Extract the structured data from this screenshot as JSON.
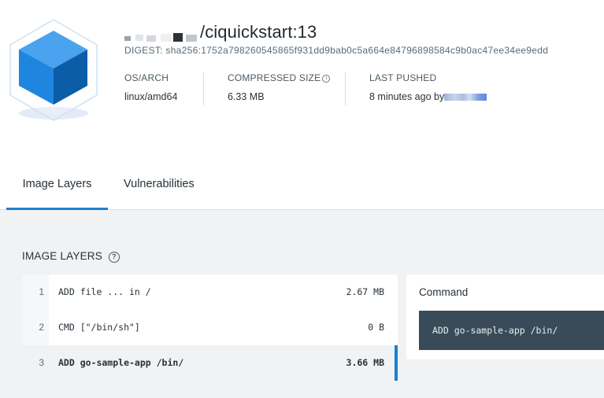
{
  "image": {
    "title_suffix": "/ciquickstart:13",
    "digest": "DIGEST: sha256:1752a798260545865f931dd9bab0c5a664e84796898584c9b0ac47ee34ee9edd"
  },
  "meta": {
    "os_arch_label": "OS/ARCH",
    "os_arch_value": "linux/amd64",
    "compressed_size_label": "COMPRESSED SIZE",
    "compressed_size_value": "6.33 MB",
    "last_pushed_label": "LAST PUSHED",
    "last_pushed_value": "8 minutes ago by"
  },
  "tabs": [
    {
      "label": "Image Layers",
      "active": true
    },
    {
      "label": "Vulnerabilities",
      "active": false
    }
  ],
  "layers_section": {
    "title": "IMAGE LAYERS",
    "rows": [
      {
        "num": "1",
        "command": "ADD file ... in /",
        "size": "2.67 MB"
      },
      {
        "num": "2",
        "command": "CMD [\"/bin/sh\"]",
        "size": "0 B"
      },
      {
        "num": "3",
        "command": "ADD go-sample-app /bin/",
        "size": "3.66 MB"
      }
    ],
    "selected_index": 2
  },
  "command_panel": {
    "label": "Command",
    "command": "ADD go-sample-app /bin/"
  },
  "colors": {
    "accent": "#1d7fd1",
    "command_box": "#394b58",
    "panel_bg": "#f0f2f4"
  },
  "icons": [
    "cube-logo-icon",
    "info-icon",
    "help-icon"
  ]
}
